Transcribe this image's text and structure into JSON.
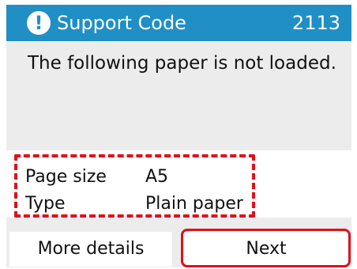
{
  "title_bar": {
    "icon": "exclamation-icon",
    "title": "Support Code",
    "code": "2113",
    "bg_color": "#1f8fc6"
  },
  "message": "The following paper is not loaded.",
  "paper_info": {
    "page_size_label": "Page size",
    "page_size_value": "A5",
    "type_label": "Type",
    "type_value": "Plain paper"
  },
  "buttons": {
    "more_details": "More details",
    "next": "Next"
  },
  "highlight_color": "#e0101a"
}
